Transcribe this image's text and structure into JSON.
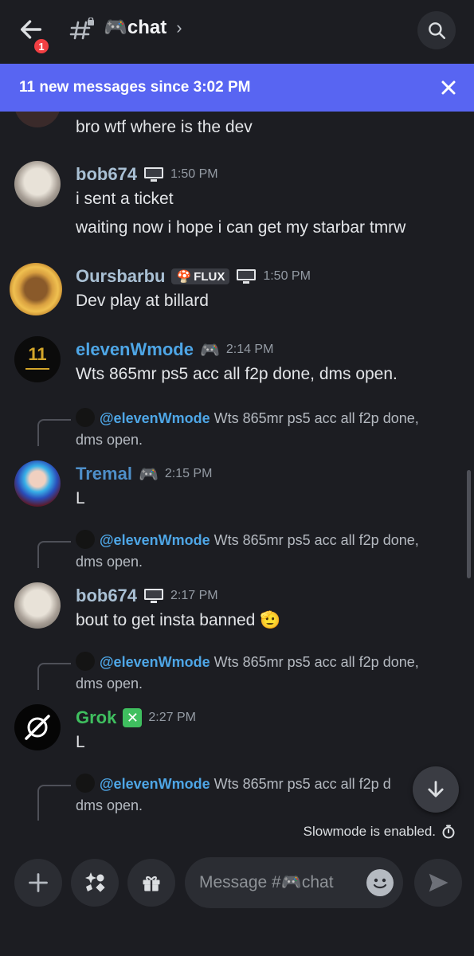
{
  "header": {
    "unread_count": "1",
    "channel_name": "🎮chat",
    "chevron": "›"
  },
  "banner": {
    "text": "11 new messages since 3:02 PM"
  },
  "messages": [
    {
      "type": "continuation",
      "text": "bro wtf where is the dev"
    },
    {
      "author": "bob674",
      "timestamp": "1:50 PM",
      "author_color": "#a9c0d4",
      "lines": [
        "i sent a ticket",
        "waiting now i hope i can get my starbar tmrw"
      ]
    },
    {
      "author": "Oursbarbu",
      "tag": "FLUX",
      "timestamp": "1:50 PM",
      "author_color": "#a9c0d4",
      "lines": [
        "Dev play at billard"
      ]
    },
    {
      "author": "elevenWmode",
      "timestamp": "2:14 PM",
      "author_color": "#4ea6e6",
      "lines": [
        "Wts 865mr ps5 acc all f2p done, dms open."
      ],
      "avatar_text": "11"
    },
    {
      "reply_to": "@elevenWmode",
      "reply_text": "Wts 865mr ps5 acc all f2p done,",
      "reply_text_2": "dms open.",
      "author": "Tremal",
      "timestamp": "2:15 PM",
      "author_color": "#4e8fc9",
      "lines": [
        "L"
      ]
    },
    {
      "reply_to": "@elevenWmode",
      "reply_text": "Wts 865mr ps5 acc all f2p done,",
      "reply_text_2": "dms open.",
      "author": "bob674",
      "timestamp": "2:17 PM",
      "author_color": "#a9c0d4",
      "lines": [
        "bout to get insta banned 🫡"
      ]
    },
    {
      "reply_to": "@elevenWmode",
      "reply_text": "Wts 865mr ps5 acc all f2p done,",
      "reply_text_2": "dms open.",
      "author": "Grok",
      "timestamp": "2:27 PM",
      "author_color": "#3fbf5f",
      "lines": [
        "L"
      ]
    },
    {
      "reply_to": "@elevenWmode",
      "reply_text": "Wts 865mr ps5 acc all f2p d",
      "reply_text_2": "dms open."
    }
  ],
  "status": {
    "slowmode": "Slowmode is enabled."
  },
  "composer": {
    "placeholder": "Message #🎮chat"
  },
  "colors": {
    "background": "#1c1d22",
    "banner": "#5865f2",
    "link": "#4ea6e6",
    "grok_green": "#3fbf5f"
  }
}
